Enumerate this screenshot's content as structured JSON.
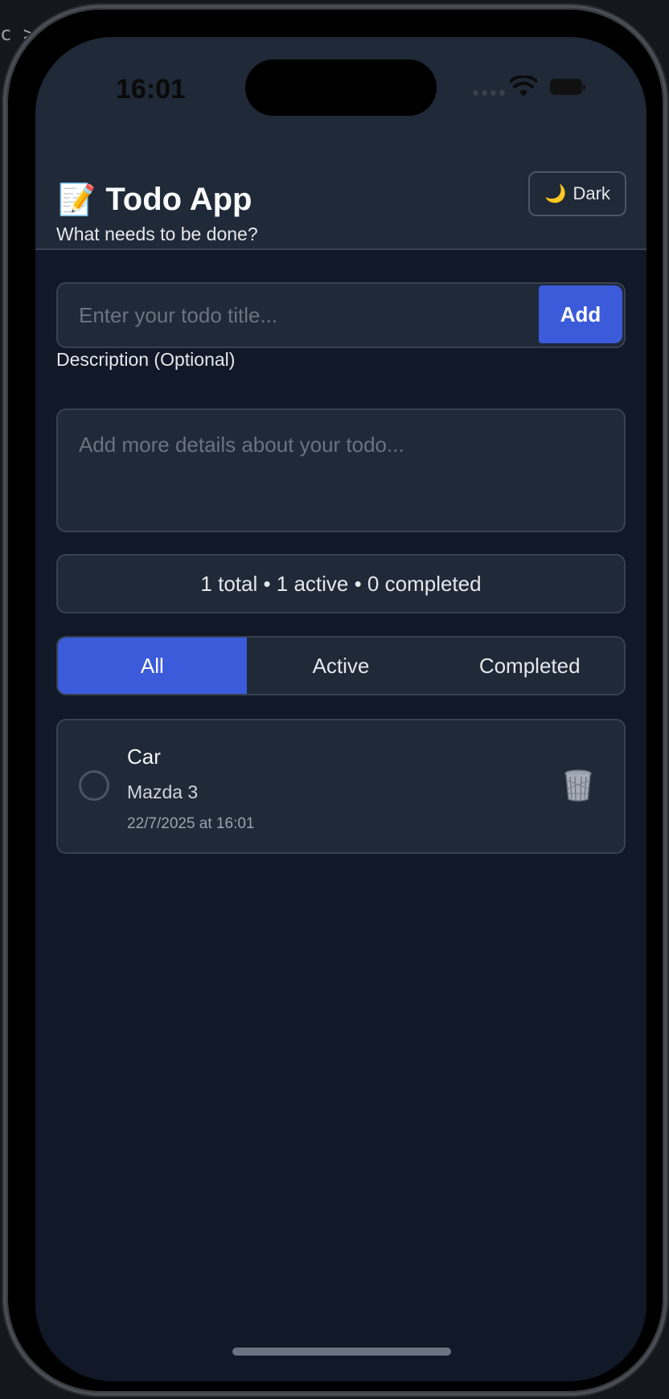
{
  "status_bar": {
    "time": "16:01"
  },
  "header": {
    "title": "Todo App",
    "title_icon": "memo-pencil-icon",
    "theme_toggle_label": "Dark",
    "theme_toggle_icon": "moon-icon"
  },
  "form": {
    "title_label": "What needs to be done?",
    "title_placeholder": "Enter your todo title...",
    "title_value": "",
    "add_label": "Add",
    "description_label": "Description (Optional)",
    "description_placeholder": "Add more details about your todo...",
    "description_value": ""
  },
  "stats": {
    "text": "1 total • 1 active • 0 completed"
  },
  "filters": {
    "tabs": [
      {
        "label": "All",
        "active": true
      },
      {
        "label": "Active",
        "active": false
      },
      {
        "label": "Completed",
        "active": false
      }
    ]
  },
  "todos": [
    {
      "title": "Car",
      "description": "Mazda 3",
      "date": "22/7/2025 at 16:01",
      "completed": false,
      "delete_icon": "trash-icon"
    }
  ],
  "colors": {
    "accent": "#3b5bdb",
    "background": "#111827",
    "surface": "#1f2937",
    "border": "#374151"
  }
}
